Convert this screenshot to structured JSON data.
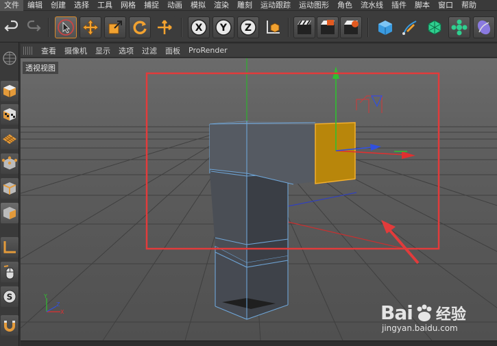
{
  "menu": [
    "文件",
    "编辑",
    "创建",
    "选择",
    "工具",
    "网格",
    "捕捉",
    "动画",
    "模拟",
    "渲染",
    "雕刻",
    "运动跟踪",
    "运动图形",
    "角色",
    "流水线",
    "插件",
    "脚本",
    "窗口",
    "帮助"
  ],
  "toolbar": {
    "axis_x": "X",
    "axis_y": "Y",
    "axis_z": "Z",
    "icons": [
      "undo-icon",
      "redo-icon",
      "select-cursor-icon",
      "move-icon",
      "scale-icon",
      "rotate-icon",
      "create-move-icon",
      "axis-x-icon",
      "axis-y-icon",
      "axis-z-icon",
      "world-coords-icon",
      "render-view-icon",
      "render-picture-viewer-icon",
      "render-settings-icon",
      "cube-icon",
      "pen-icon",
      "subdivision-icon",
      "cloner-icon",
      "deformer-icon"
    ]
  },
  "leftbar": [
    "viewport-grid-icon",
    "model-mode-icon",
    "texture-mode-icon",
    "workplane-icon",
    "points-mode-icon",
    "edges-mode-icon",
    "polygons-mode-icon",
    "axis-mode-icon",
    "mouse-icon",
    "snap-s-icon",
    "magnet-icon"
  ],
  "viewport_menu": [
    "查看",
    "摄像机",
    "显示",
    "选项",
    "过滤",
    "面板",
    "ProRender"
  ],
  "viewport": {
    "label": "透视视图",
    "axis_labels": {
      "x": "X",
      "y": "Y",
      "z": "Z"
    }
  },
  "watermark": {
    "logo": "Bai",
    "logo_cn": "经验",
    "url": "jingyan.baidu.com"
  },
  "colors": {
    "highlight": "#e23b3b",
    "selection": "#f0a020",
    "wireframe": "#6fa6d8",
    "axis_x": "#e03030",
    "axis_y": "#30c030",
    "axis_z": "#3050e0"
  }
}
